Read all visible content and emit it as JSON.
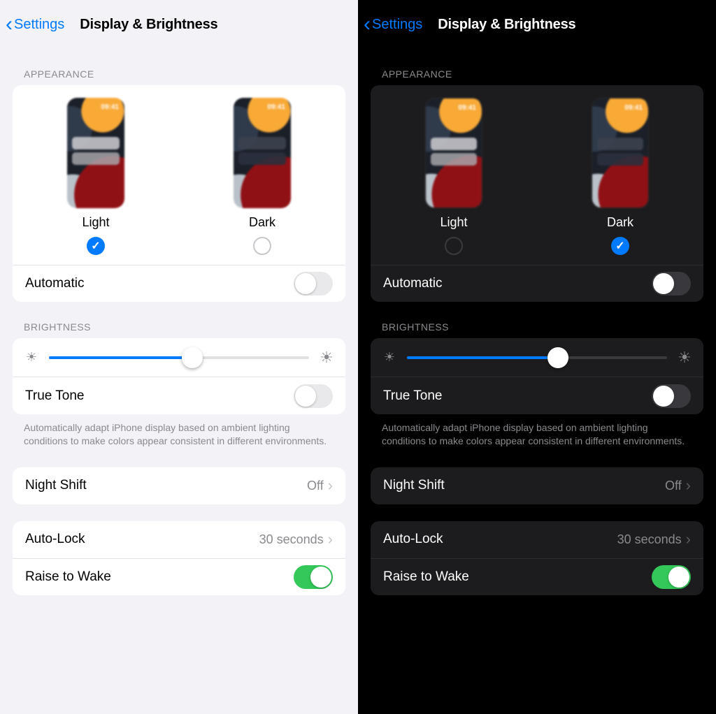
{
  "nav": {
    "back": "Settings",
    "title": "Display & Brightness"
  },
  "appearance": {
    "section": "APPEARANCE",
    "light_label": "Light",
    "dark_label": "Dark",
    "clock": "09:41",
    "automatic_label": "Automatic",
    "left_selected": "light",
    "right_selected": "dark",
    "automatic_on": false
  },
  "brightness": {
    "section": "BRIGHTNESS",
    "left_value_pct": 55,
    "right_value_pct": 58,
    "truetone_label": "True Tone",
    "truetone_on": false,
    "note": "Automatically adapt iPhone display based on ambient lighting conditions to make colors appear consistent in different environments."
  },
  "nightshift": {
    "label": "Night Shift",
    "value": "Off"
  },
  "autolock": {
    "label": "Auto-Lock",
    "value": "30 seconds"
  },
  "raise": {
    "label": "Raise to Wake",
    "on": true
  }
}
